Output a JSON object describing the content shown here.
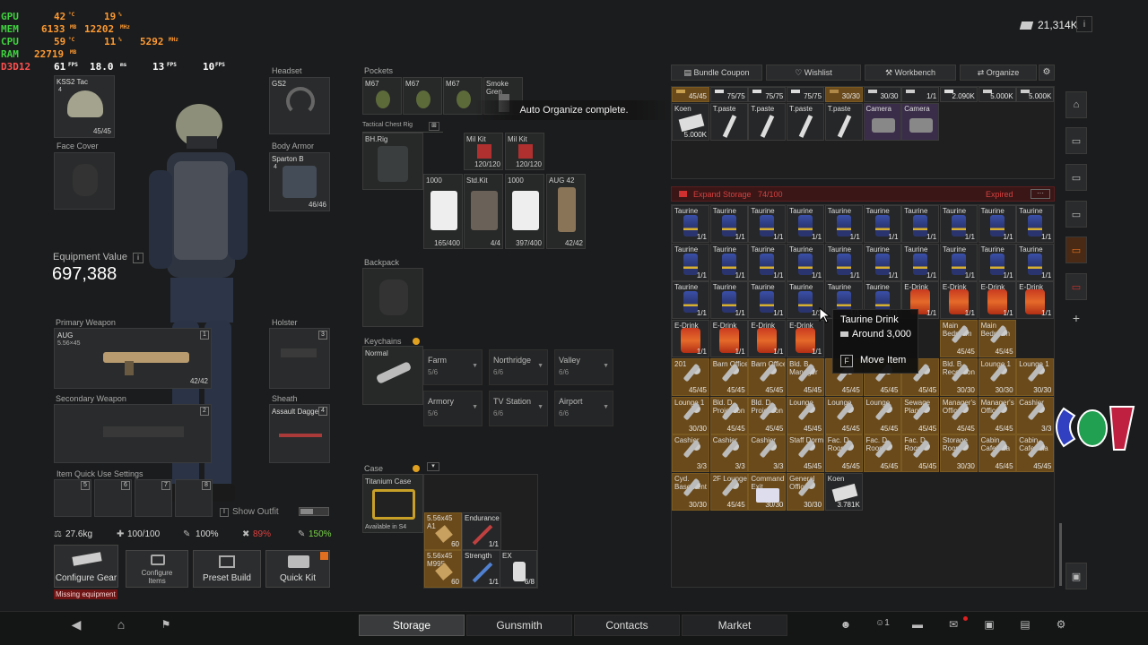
{
  "overlay": {
    "rows": [
      {
        "label": "GPU",
        "v1": "42",
        "u1": "°C",
        "v2": "19",
        "u2": "%"
      },
      {
        "label": "MEM",
        "v1": "6133",
        "u1": "MB",
        "v2": "12202",
        "u2": "MHz"
      },
      {
        "label": "CPU",
        "v1": "59",
        "u1": "°C",
        "v2": "11",
        "u2": "%",
        "v3": "5292",
        "u3": "MHz"
      },
      {
        "label": "RAM",
        "v1": "22719",
        "u1": "MB"
      },
      {
        "label": "D3D12",
        "v1": "61",
        "u1": "FPS",
        "v2": "18.0",
        "u2": "ms",
        "v3": "13",
        "u3": "FPS",
        "v4": "10",
        "u4": "FPS"
      }
    ]
  },
  "currency": {
    "amount": "21,314K"
  },
  "gear": {
    "headwear": {
      "name": "KSS2 Tac",
      "count": "45/45",
      "level": "4"
    },
    "headset": {
      "label": "Headset",
      "name": "GS2"
    },
    "face_cover": {
      "label": "Face Cover"
    },
    "body_armor": {
      "label": "Body Armor",
      "name": "Sparton B",
      "count": "46/46",
      "level": "4"
    },
    "equipment_value_label": "Equipment Value",
    "equipment_value": "697,388",
    "primary": {
      "label": "Primary Weapon",
      "name": "AUG",
      "sub": "5.56×45",
      "count": "42/42",
      "slot": "1"
    },
    "holster": {
      "label": "Holster",
      "slot": "3"
    },
    "secondary": {
      "label": "Secondary Weapon",
      "slot": "2"
    },
    "sheath": {
      "label": "Sheath",
      "name": "Assault Dagge",
      "slot": "4"
    },
    "quick_use": {
      "label": "Item Quick Use Settings",
      "slots": [
        "5",
        "6",
        "7",
        "8"
      ]
    },
    "show_outfit": "Show Outfit"
  },
  "stats": {
    "weight": "27.6kg",
    "health": "100/100",
    "hydration": "100%",
    "energy": "89%",
    "stamina": "150%"
  },
  "buttons": {
    "configure_gear": "Configure Gear",
    "configure_items": "Configure Items",
    "preset_build": "Preset Build",
    "quick_kit": "Quick Kit",
    "missing": "Missing equipment"
  },
  "pockets": {
    "label": "Pockets",
    "items": [
      "M67",
      "M67",
      "M67",
      "Smoke Gren"
    ],
    "toast": "Auto Organize complete."
  },
  "rig": {
    "label": "Tactical Chest Rig",
    "name": "BH.Rig",
    "items": [
      {
        "name": "Mil Kit",
        "count": "120/120"
      },
      {
        "name": "Mil Kit",
        "count": "120/120"
      },
      {
        "name": "1000",
        "count": "165/400"
      },
      {
        "name": "Std.Kit",
        "count": "4/4"
      },
      {
        "name": "1000",
        "count": "397/400"
      },
      {
        "name": "AUG 42",
        "count": "42/42"
      }
    ]
  },
  "backpack": {
    "label": "Backpack"
  },
  "keychains": {
    "label": "Keychains",
    "name": "Normal",
    "maps": [
      {
        "name": "Farm",
        "count": "5/6"
      },
      {
        "name": "Northridge",
        "count": "6/6"
      },
      {
        "name": "Valley",
        "count": "6/6"
      },
      {
        "name": "Armory",
        "count": "5/6"
      },
      {
        "name": "TV Station",
        "count": "6/6"
      },
      {
        "name": "Airport",
        "count": "6/6"
      }
    ]
  },
  "case": {
    "label": "Case",
    "name": "Titanium Case",
    "avail": "Available in S4",
    "items": [
      {
        "name": "5.56x45 A1",
        "count": "60"
      },
      {
        "name": "Endurance",
        "count": "1/1"
      },
      {
        "name": "5.56x45 M995",
        "count": "60"
      },
      {
        "name": "Strength",
        "count": "1/1"
      },
      {
        "name": "EX",
        "count": "6/8"
      }
    ]
  },
  "tabs_top": {
    "bundle": "Bundle Coupon",
    "wishlist": "Wishlist",
    "workbench": "Workbench",
    "organize": "Organize"
  },
  "stash_top": {
    "row1": [
      "45/45",
      "75/75",
      "75/75",
      "75/75",
      "30/30",
      "30/30",
      "1/1",
      "2.090K",
      "5.000K",
      "5.000K"
    ],
    "row2": [
      {
        "name": "Koen",
        "count": "5.000K"
      },
      {
        "name": "T.paste",
        "count": ""
      },
      {
        "name": "T.paste",
        "count": ""
      },
      {
        "name": "T.paste",
        "count": ""
      },
      {
        "name": "T.paste",
        "count": ""
      },
      {
        "name": "Camera",
        "count": ""
      },
      {
        "name": "Camera",
        "count": ""
      }
    ]
  },
  "expand": {
    "label": "Expand Storage",
    "count": "74/100",
    "status": "Expired"
  },
  "storage": {
    "taurine": "Taurine",
    "edrink": "E-Drink",
    "one": "1/1",
    "row4extra": [
      {
        "name": "Main Bedroom",
        "count": "45/45"
      },
      {
        "name": "Main Bedroom",
        "count": "45/45"
      }
    ],
    "row5": [
      {
        "name": "201",
        "count": "45/45"
      },
      {
        "name": "Barn Office",
        "count": "45/45"
      },
      {
        "name": "Barn Office",
        "count": "45/45"
      },
      {
        "name": "Bld. B Manager",
        "count": "45/45"
      },
      {
        "name": "",
        "count": "45/45"
      },
      {
        "name": "",
        "count": "45/45"
      },
      {
        "name": "",
        "count": "45/45"
      },
      {
        "name": "Bld. B Reception",
        "count": "30/30"
      },
      {
        "name": "Lounge 1",
        "count": "30/30"
      },
      {
        "name": "Lounge 1",
        "count": "30/30"
      }
    ],
    "row6": [
      {
        "name": "Lounge 1",
        "count": "30/30"
      },
      {
        "name": "Bld. D Projection",
        "count": "45/45"
      },
      {
        "name": "Bld. D Projection",
        "count": "45/45"
      },
      {
        "name": "Lounge",
        "count": "45/45"
      },
      {
        "name": "Lounge",
        "count": "45/45"
      },
      {
        "name": "Lounge",
        "count": "45/45"
      },
      {
        "name": "Sewage Plant",
        "count": "45/45"
      },
      {
        "name": "Manager's Office",
        "count": "45/45"
      },
      {
        "name": "Manager's Office",
        "count": "45/45"
      },
      {
        "name": "Cashier",
        "count": "3/3"
      }
    ],
    "row7": [
      {
        "name": "Cashier",
        "count": "3/3"
      },
      {
        "name": "Cashier",
        "count": "3/3"
      },
      {
        "name": "Cashier",
        "count": "3/3"
      },
      {
        "name": "Staff Dorm",
        "count": "45/45"
      },
      {
        "name": "Fac. D Room",
        "count": "45/45"
      },
      {
        "name": "Fac. D Room",
        "count": "45/45"
      },
      {
        "name": "Fac. D Room",
        "count": "45/45"
      },
      {
        "name": "Storage Room",
        "count": "30/30"
      },
      {
        "name": "Cabin Cafeteria",
        "count": "45/45"
      },
      {
        "name": "Cabin Cafeteria",
        "count": "45/45"
      }
    ],
    "row8": [
      {
        "name": "Cyd. Basement",
        "count": "30/30"
      },
      {
        "name": "2F Lounge",
        "count": "45/45"
      },
      {
        "name": "Command Exit",
        "count": "30/30"
      },
      {
        "name": "General Office",
        "count": "30/30"
      },
      {
        "name": "Koen",
        "count": "3.781K"
      }
    ]
  },
  "tooltip": {
    "name": "Taurine Drink",
    "price": "Around 3,000",
    "key": "F",
    "action": "Move Item"
  },
  "nav": {
    "storage": "Storage",
    "gunsmith": "Gunsmith",
    "contacts": "Contacts",
    "market": "Market",
    "party_count": "1"
  }
}
